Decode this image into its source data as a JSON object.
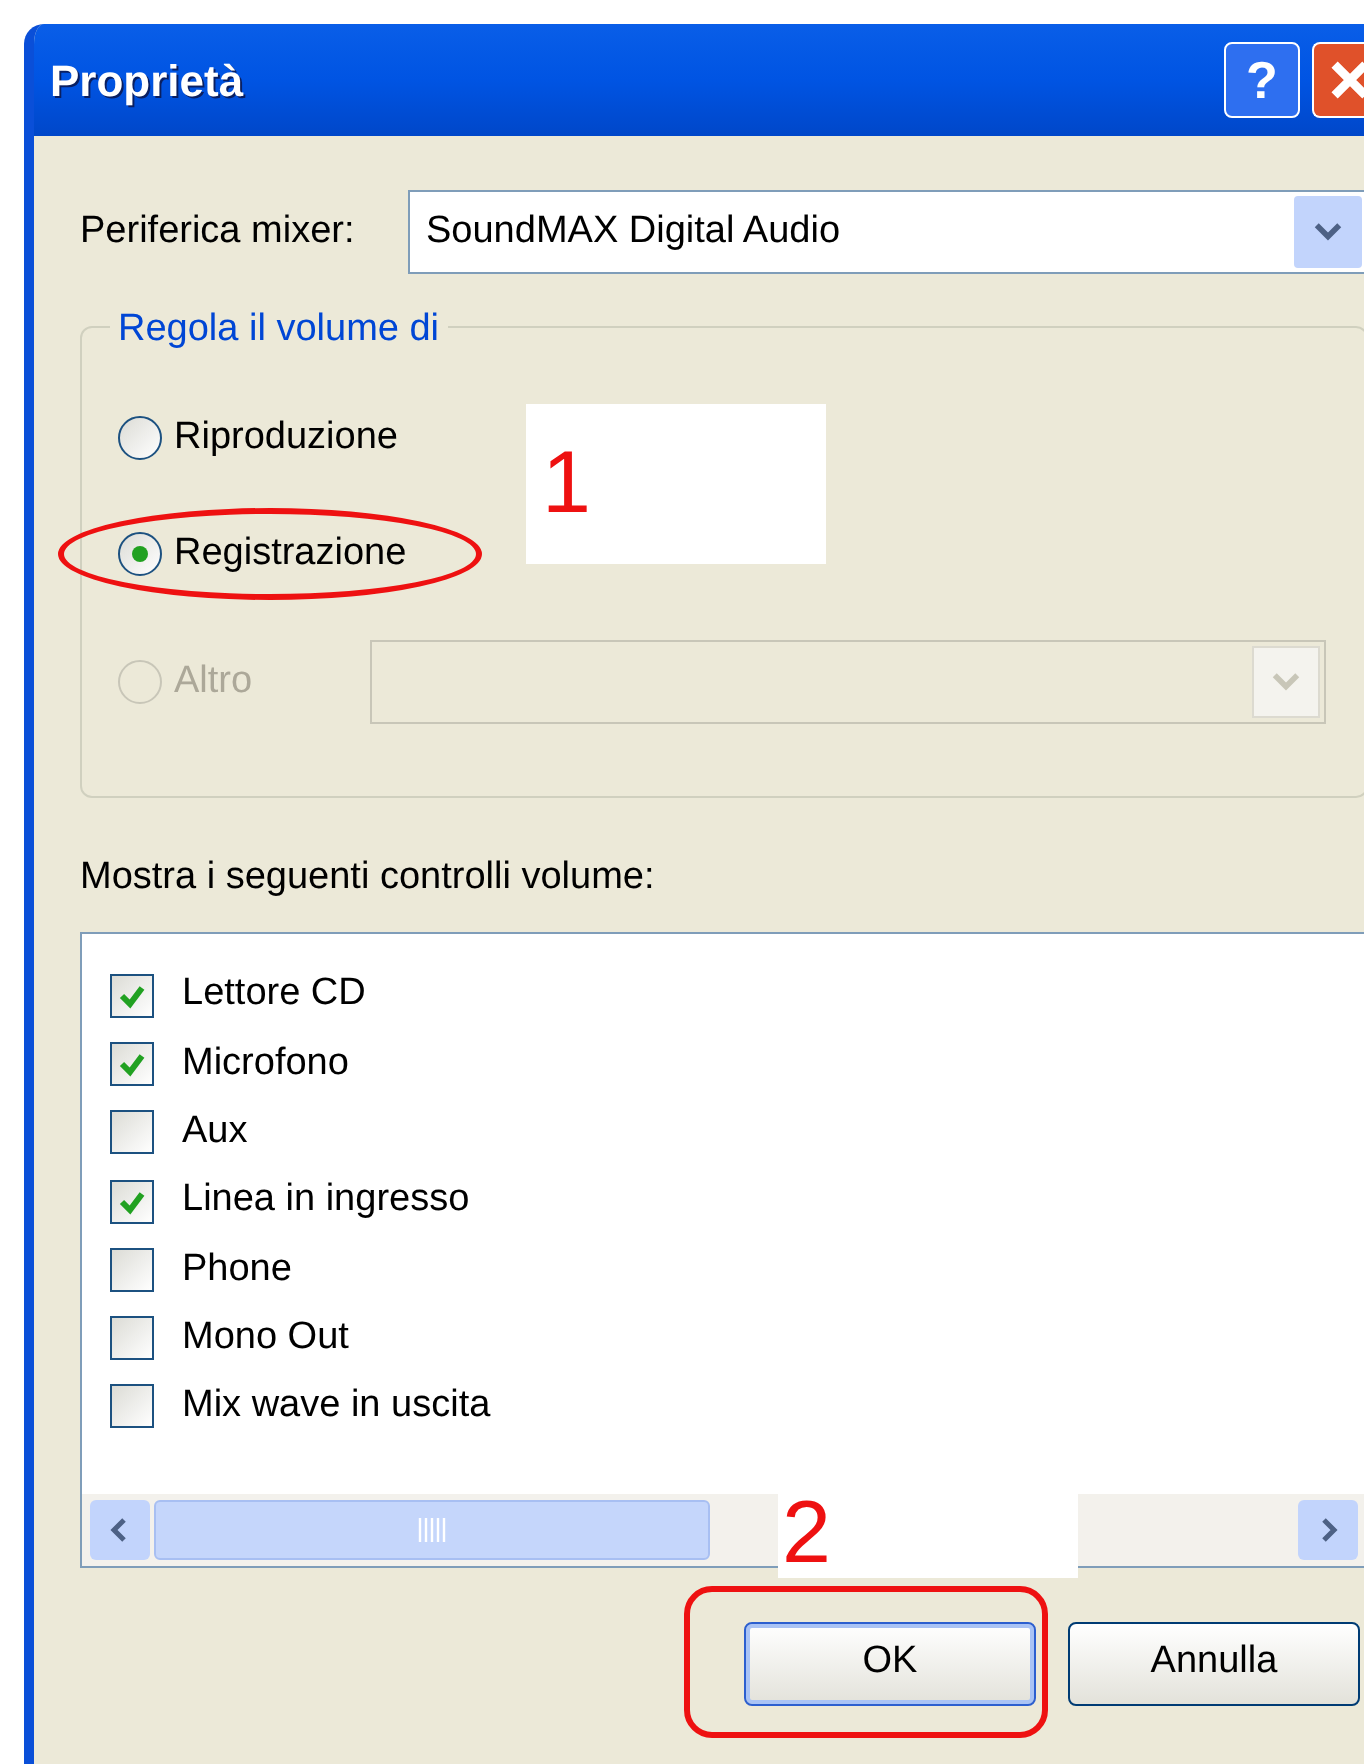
{
  "window": {
    "title": "Proprietà",
    "help_button": "?"
  },
  "mixer": {
    "label": "Periferica mixer:",
    "value": "SoundMAX Digital Audio"
  },
  "volume_group": {
    "legend": "Regola il volume di",
    "options": [
      {
        "label": "Riproduzione",
        "selected": false,
        "disabled": false
      },
      {
        "label": "Registrazione",
        "selected": true,
        "disabled": false
      },
      {
        "label": "Altro",
        "selected": false,
        "disabled": true
      }
    ]
  },
  "controls_label": "Mostra i seguenti controlli volume:",
  "controls": [
    {
      "label": "Lettore CD",
      "checked": true
    },
    {
      "label": "Microfono",
      "checked": true
    },
    {
      "label": "Aux",
      "checked": false
    },
    {
      "label": "Linea in ingresso",
      "checked": true
    },
    {
      "label": "Phone",
      "checked": false
    },
    {
      "label": "Mono Out",
      "checked": false
    },
    {
      "label": "Mix wave in uscita",
      "checked": false
    }
  ],
  "buttons": [
    "OK",
    "Annulla"
  ],
  "annotations": [
    "1",
    "2"
  ]
}
